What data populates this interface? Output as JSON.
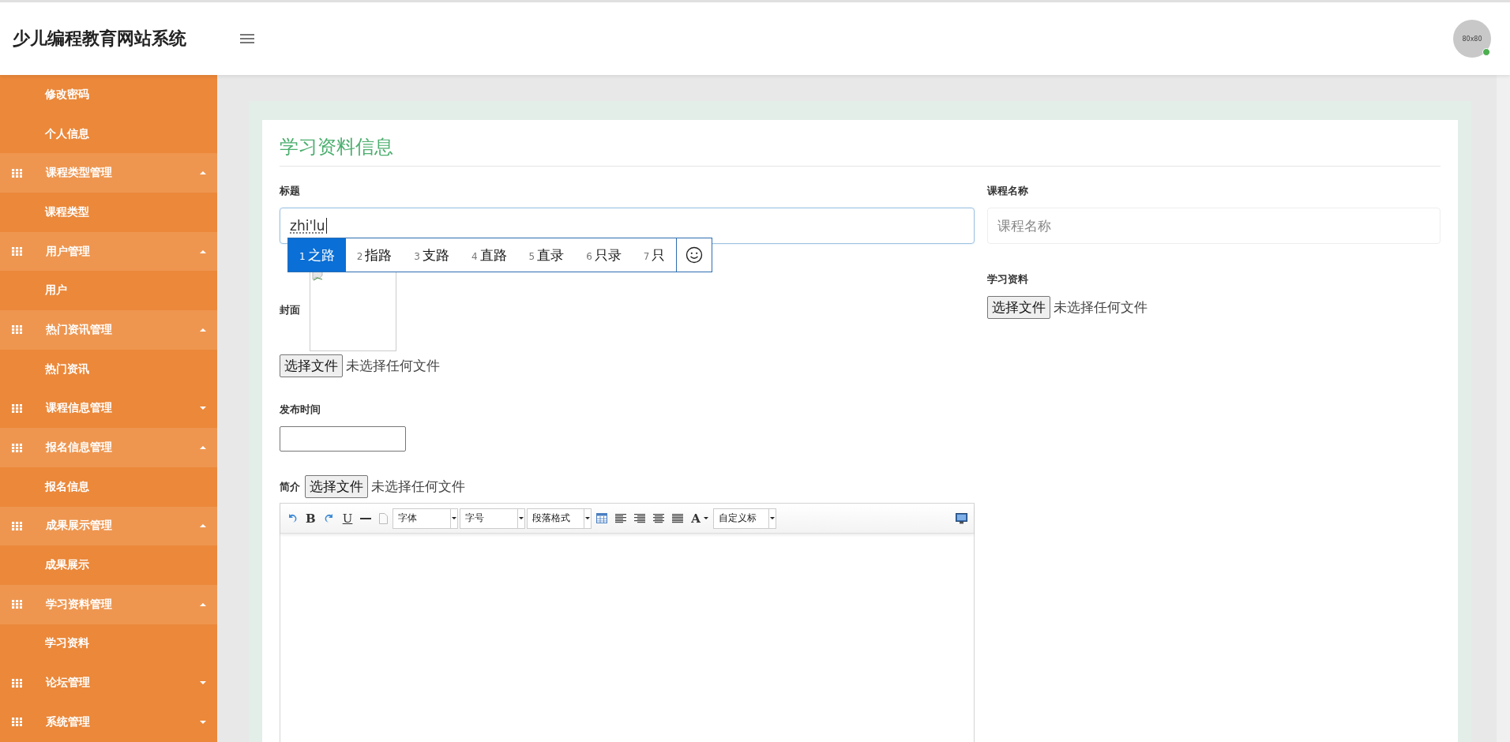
{
  "header": {
    "title": "少儿编程教育网站系统",
    "avatar_text": "80x80",
    "online": true
  },
  "sidebar": {
    "items": [
      {
        "kind": "link",
        "label": "修改密码"
      },
      {
        "kind": "link",
        "label": "个人信息"
      },
      {
        "kind": "group",
        "label": "课程类型管理",
        "expanded": true,
        "children": [
          {
            "label": "课程类型"
          }
        ]
      },
      {
        "kind": "group",
        "label": "用户管理",
        "expanded": true,
        "children": [
          {
            "label": "用户"
          }
        ]
      },
      {
        "kind": "group",
        "label": "热门资讯管理",
        "expanded": true,
        "children": [
          {
            "label": "热门资讯"
          }
        ]
      },
      {
        "kind": "group",
        "label": "课程信息管理",
        "expanded": false
      },
      {
        "kind": "group",
        "label": "报名信息管理",
        "expanded": true,
        "children": [
          {
            "label": "报名信息"
          }
        ]
      },
      {
        "kind": "group",
        "label": "成果展示管理",
        "expanded": true,
        "children": [
          {
            "label": "成果展示"
          }
        ]
      },
      {
        "kind": "group",
        "label": "学习资料管理",
        "expanded": true,
        "children": [
          {
            "label": "学习资料"
          }
        ]
      },
      {
        "kind": "group",
        "label": "论坛管理",
        "expanded": false
      },
      {
        "kind": "group",
        "label": "系统管理",
        "expanded": false
      }
    ]
  },
  "form": {
    "title": "学习资料信息",
    "title_field": {
      "label": "标题",
      "value": "zhi'lu"
    },
    "course_name": {
      "label": "课程名称",
      "placeholder": "课程名称"
    },
    "cover": {
      "label": "封面",
      "button": "选择文件",
      "status": "未选择任何文件"
    },
    "material": {
      "label": "学习资料",
      "button": "选择文件",
      "status": "未选择任何文件"
    },
    "publish_time": {
      "label": "发布时间"
    },
    "intro": {
      "label": "简介",
      "button": "选择文件",
      "status": "未选择任何文件"
    },
    "editor": {
      "bold": "B",
      "underline": "U",
      "font_color": "A",
      "dropdowns": [
        "字体",
        "字号",
        "段落格式",
        "自定义标"
      ]
    }
  },
  "ime": {
    "candidates": [
      {
        "index": "1",
        "text": "之路",
        "selected": true
      },
      {
        "index": "2",
        "text": "指路",
        "selected": false
      },
      {
        "index": "3",
        "text": "支路",
        "selected": false
      },
      {
        "index": "4",
        "text": "直路",
        "selected": false
      },
      {
        "index": "5",
        "text": "直录",
        "selected": false
      },
      {
        "index": "6",
        "text": "只录",
        "selected": false
      },
      {
        "index": "7",
        "text": "只",
        "selected": false
      }
    ]
  }
}
